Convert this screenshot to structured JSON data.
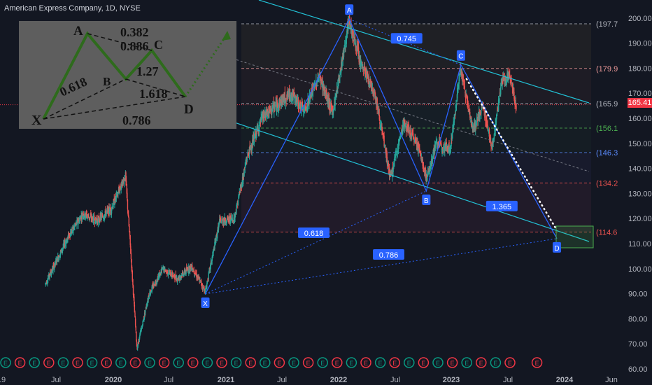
{
  "title": "American Express Company, 1D, NYSE",
  "last_price": "165.41",
  "colors": {
    "up": "#26a69a",
    "down": "#ef5350",
    "pattern": "#2962ff",
    "channel": "#22c1d6",
    "bg": "#131722"
  },
  "chart_data": {
    "type": "candlestick",
    "title": "American Express Company, 1D, NYSE",
    "x_ticks": [
      "19",
      "Jul",
      "2020",
      "Jul",
      "2021",
      "Jul",
      "2022",
      "Jul",
      "2023",
      "Jul",
      "2024",
      "Jun"
    ],
    "y_ticks": [
      "60.00",
      "70.00",
      "80.00",
      "90.00",
      "100.00",
      "110.00",
      "120.00",
      "130.00",
      "140.00",
      "150.00",
      "160.00",
      "170.00",
      "180.00",
      "190.00",
      "200.00"
    ],
    "ylim": [
      58,
      205
    ],
    "price_series": [
      [
        "2019-06-01",
        94
      ],
      [
        "2019-08-15",
        113
      ],
      [
        "2019-10-01",
        122
      ],
      [
        "2019-11-15",
        119
      ],
      [
        "2019-12-31",
        124
      ],
      [
        "2020-02-15",
        137
      ],
      [
        "2020-03-01",
        110
      ],
      [
        "2020-03-23",
        68
      ],
      [
        "2020-05-01",
        90
      ],
      [
        "2020-06-15",
        100
      ],
      [
        "2020-08-01",
        96
      ],
      [
        "2020-09-15",
        101
      ],
      [
        "2020-10-30",
        91
      ],
      [
        "2020-12-15",
        119
      ],
      [
        "2021-01-31",
        120
      ],
      [
        "2021-03-15",
        145
      ],
      [
        "2021-05-01",
        160
      ],
      [
        "2021-06-15",
        165
      ],
      [
        "2021-08-01",
        170
      ],
      [
        "2021-09-15",
        163
      ],
      [
        "2021-11-01",
        177
      ],
      [
        "2021-12-15",
        162
      ],
      [
        "2022-02-07",
        199
      ],
      [
        "2022-03-15",
        182
      ],
      [
        "2022-05-01",
        170
      ],
      [
        "2022-06-20",
        136
      ],
      [
        "2022-08-01",
        158
      ],
      [
        "2022-09-15",
        150
      ],
      [
        "2022-10-15",
        136
      ],
      [
        "2022-11-15",
        150
      ],
      [
        "2022-12-31",
        148
      ],
      [
        "2023-02-01",
        180
      ],
      [
        "2023-03-15",
        155
      ],
      [
        "2023-04-15",
        165
      ],
      [
        "2023-05-15",
        148
      ],
      [
        "2023-06-15",
        175
      ],
      [
        "2023-07-10",
        177
      ],
      [
        "2023-08-01",
        165
      ]
    ],
    "harmonic_points": [
      {
        "label": "X",
        "date": "2020-10-30",
        "value": 89.9
      },
      {
        "label": "A",
        "date": "2022-02-07",
        "value": 199.6
      },
      {
        "label": "B",
        "date": "2022-10-14",
        "value": 131.0
      },
      {
        "label": "C",
        "date": "2023-02-03",
        "value": 181.3
      },
      {
        "label": "D",
        "date": "2023-12-10",
        "value": 112.0
      }
    ],
    "ratios": [
      "0.745",
      "0.618",
      "1.365",
      "0.786"
    ],
    "levels": [
      {
        "label": "(197.7",
        "value": 197.7,
        "color": "#b2b5be"
      },
      {
        "label": "(179.9",
        "value": 179.9,
        "color": "#ef9a9a"
      },
      {
        "label": "(165.9",
        "value": 165.9,
        "color": "#b2b5be"
      },
      {
        "label": "(156.1",
        "value": 156.1,
        "color": "#4caf50"
      },
      {
        "label": "(146.3",
        "value": 146.3,
        "color": "#5b8cff"
      },
      {
        "label": "(134.2",
        "value": 134.2,
        "color": "#ef5350"
      },
      {
        "label": "(114.6",
        "value": 114.6,
        "color": "#ef5350"
      }
    ],
    "events": [
      "E",
      "E",
      "E",
      "E",
      "E",
      "E",
      "E",
      "E",
      "E",
      "E",
      "E",
      "E",
      "E",
      "E",
      "E",
      "E",
      "E",
      "E",
      "E",
      "E",
      "E",
      "E",
      "E",
      "E",
      "E",
      "E",
      "E",
      "E",
      "E",
      "E",
      "E",
      "E",
      "E",
      "E",
      "E",
      "E",
      "E"
    ]
  },
  "inset": {
    "points": [
      "X",
      "A",
      "B",
      "C",
      "D"
    ],
    "ratios": [
      "0.382",
      "0.886",
      "0.618",
      "1.27",
      "1.618",
      "0.786"
    ]
  }
}
